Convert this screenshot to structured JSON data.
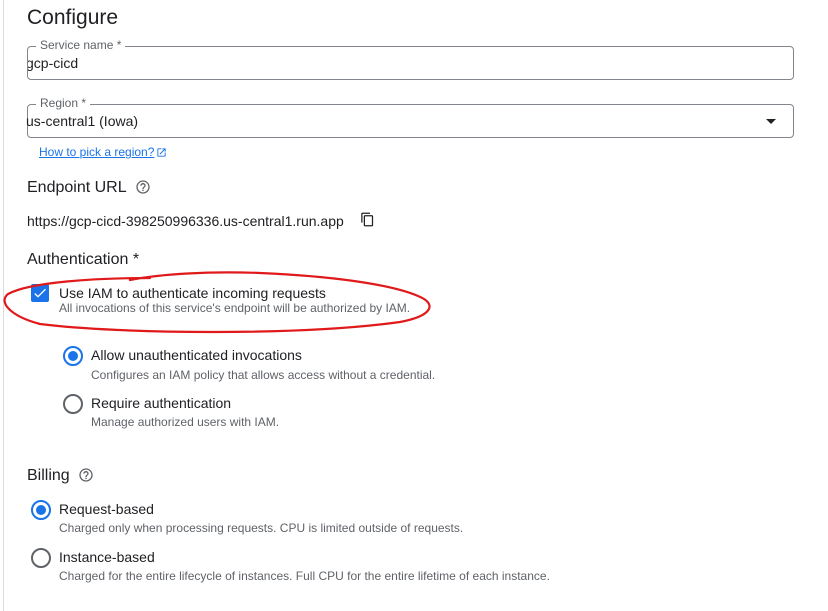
{
  "page": {
    "title": "Configure"
  },
  "service_name": {
    "label": "Service name *",
    "value": "gcp-cicd"
  },
  "region": {
    "label": "Region *",
    "value": "us-central1 (Iowa)",
    "help_link": "How to pick a region?"
  },
  "endpoint": {
    "title": "Endpoint URL",
    "url": "https://gcp-cicd-398250996336.us-central1.run.app"
  },
  "authentication": {
    "title": "Authentication *",
    "iam_checkbox": {
      "checked": true,
      "label": "Use IAM to authenticate incoming requests",
      "description": "All invocations of this service's endpoint will be authorized by IAM."
    },
    "options": [
      {
        "label": "Allow unauthenticated invocations",
        "description": "Configures an IAM policy that allows access without a credential.",
        "selected": true
      },
      {
        "label": "Require authentication",
        "description": "Manage authorized users with IAM.",
        "selected": false
      }
    ]
  },
  "billing": {
    "title": "Billing",
    "options": [
      {
        "label": "Request-based",
        "description": "Charged only when processing requests. CPU is limited outside of requests.",
        "selected": true
      },
      {
        "label": "Instance-based",
        "description": "Charged for the entire lifecycle of instances. Full CPU for the entire lifetime of each instance.",
        "selected": false
      }
    ]
  },
  "colors": {
    "accent": "#1a73e8",
    "annotation": "#e0191b",
    "text": "#202124",
    "secondary": "#5f6368"
  }
}
